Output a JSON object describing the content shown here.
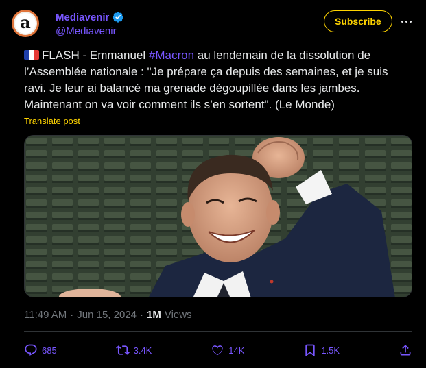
{
  "author": {
    "name": "Mediavenir",
    "handle": "@Mediavenir",
    "avatar_glyph": "a"
  },
  "subscribe_label": "Subscribe",
  "tweet": {
    "flag": "FR",
    "text_before": "FLASH - Emmanuel ",
    "hashtag": "#Macron",
    "text_after": " au lendemain de la dissolution de l’Assemblée nationale : \"Je prépare ça depuis des semaines, et je suis ravi. Je leur ai balancé ma grenade dégoupillée dans les jambes. Maintenant on va voir comment ils s’en sortent\". (Le Monde)"
  },
  "translate_label": "Translate post",
  "meta": {
    "time": "11:49 AM",
    "separator": "·",
    "date": "Jun 15, 2024",
    "separator2": "·",
    "views_count": "1M",
    "views_label": "Views"
  },
  "actions": {
    "replies": "685",
    "reposts": "3.4K",
    "likes": "14K",
    "bookmarks": "1.5K"
  },
  "colors": {
    "accent": "#7856ff",
    "translate": "#ffd400",
    "subscribe_border": "#ffd400"
  }
}
